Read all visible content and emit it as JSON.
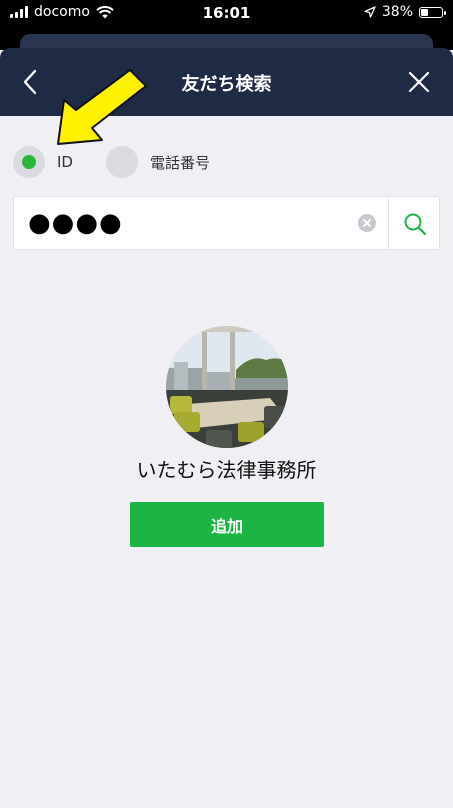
{
  "status_bar": {
    "carrier": "docomo",
    "time": "16:01",
    "battery_percent": "38%",
    "battery_level": 0.38
  },
  "header": {
    "title": "友だち検索",
    "back_icon": "chevron-left-icon",
    "close_icon": "close-icon"
  },
  "search_type": {
    "options": [
      {
        "label": "ID",
        "selected": true
      },
      {
        "label": "電話番号",
        "selected": false
      }
    ]
  },
  "search": {
    "value": "●●●●",
    "search_icon": "search-icon"
  },
  "profile": {
    "name": "いたむら法律事務所",
    "add_label": "追加"
  },
  "colors": {
    "header": "#1f2b45",
    "accent_green": "#1db446",
    "radio_selected": "#2ab53b",
    "background": "#efeff4",
    "arrow": "#fff200"
  }
}
